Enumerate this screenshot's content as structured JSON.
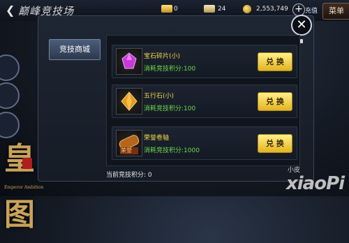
{
  "header": {
    "back_label": "❮",
    "title": "巅峰竞技场",
    "resources": [
      {
        "icon": "gold-ingot-icon",
        "value": "0"
      },
      {
        "icon": "silver-ingot-icon",
        "value": "24"
      },
      {
        "icon": "coin-icon",
        "value": "2,553,749"
      }
    ],
    "recharge_label": "充值",
    "menu_label": "菜单"
  },
  "panel": {
    "close_label": "✕",
    "mall_button": "竞技商城",
    "items": [
      {
        "name": "宝石碎片(小)",
        "cost": "消耗竞技积分:100",
        "button": "兑 换",
        "icon": "gem-fragment-icon"
      },
      {
        "name": "五行石(小)",
        "cost": "消耗竞技积分:100",
        "button": "兑 换",
        "icon": "five-elements-stone-icon"
      },
      {
        "name": "荣誉卷轴",
        "cost": "消耗竞技积分:1000",
        "button": "兑 换",
        "icon": "honor-scroll-icon",
        "icon_text": "荣誉"
      }
    ],
    "points_label": "当前竞技积分: 0"
  },
  "logo": {
    "char": "皇图",
    "subtitle": "Emperor Ambition"
  },
  "watermark": {
    "small": "小皮",
    "large": "xiaoPi"
  }
}
